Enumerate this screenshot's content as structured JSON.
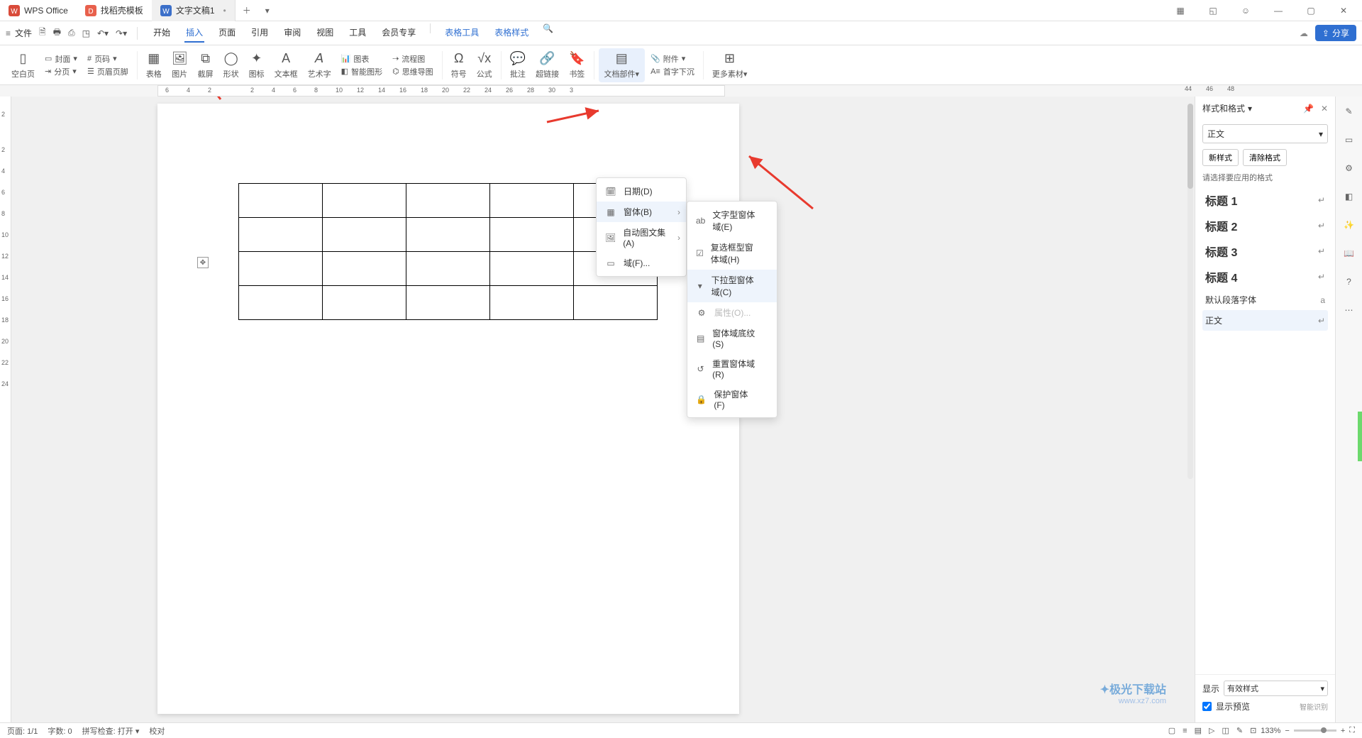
{
  "titlebar": {
    "app": "WPS Office",
    "tab_template": "找稻壳模板",
    "tab_doc": "文字文稿1"
  },
  "menubar": {
    "file": "文件",
    "tabs": [
      "开始",
      "插入",
      "页面",
      "引用",
      "审阅",
      "视图",
      "工具",
      "会员专享"
    ],
    "extra": [
      "表格工具",
      "表格样式"
    ],
    "active_index": 1,
    "share": "分享"
  },
  "ribbon": {
    "blank_page": "空白页",
    "cover": "封面",
    "page_num": "页码",
    "page_break": "分页",
    "header_footer": "页眉页脚",
    "table": "表格",
    "picture": "图片",
    "screenshot": "截屏",
    "shape": "形状",
    "icon": "图标",
    "textbox": "文本框",
    "wordart": "艺术字",
    "chart": "图表",
    "smartart": "智能图形",
    "flowchart": "流程图",
    "mindmap": "思维导图",
    "symbol": "符号",
    "equation": "公式",
    "comment": "批注",
    "hyperlink": "超链接",
    "bookmark": "书签",
    "doc_parts": "文档部件",
    "attachment": "附件",
    "dropcap": "首字下沉",
    "more": "更多素材"
  },
  "menu1": {
    "date": "日期(D)",
    "form": "窗体(B)",
    "autotext": "自动图文集(A)",
    "field": "域(F)..."
  },
  "menu2": {
    "text_field": "文字型窗体域(E)",
    "checkbox_field": "复选框型窗体域(H)",
    "dropdown_field": "下拉型窗体域(C)",
    "properties": "属性(O)...",
    "shading": "窗体域底纹(S)",
    "reset": "重置窗体域(R)",
    "protect": "保护窗体(F)"
  },
  "styles_panel": {
    "title": "样式和格式",
    "current": "正文",
    "new_style": "新样式",
    "clear": "清除格式",
    "hint": "请选择要应用的格式",
    "list": [
      "标题 1",
      "标题 2",
      "标题 3",
      "标题 4"
    ],
    "default_para": "默认段落字体",
    "body": "正文",
    "show_label": "显示",
    "show_value": "有效样式",
    "preview": "显示预览"
  },
  "statusbar": {
    "page": "页面: 1/1",
    "words": "字数: 0",
    "spell": "拼写检查: 打开",
    "proof": "校对",
    "zoom": "133%"
  },
  "watermark": {
    "site": "www.xz7.com",
    "name": "极光下载站"
  },
  "ruler_h": [
    "6",
    "4",
    "2",
    "2",
    "4",
    "6",
    "8",
    "10",
    "12",
    "14",
    "16",
    "18",
    "20",
    "22",
    "24",
    "26",
    "28",
    "30",
    "3"
  ],
  "ruler_h_after": [
    "44",
    "46",
    "48"
  ],
  "ruler_v": [
    "2",
    "2",
    "4",
    "6",
    "8",
    "10",
    "12",
    "14",
    "16",
    "18",
    "20",
    "22",
    "24"
  ]
}
